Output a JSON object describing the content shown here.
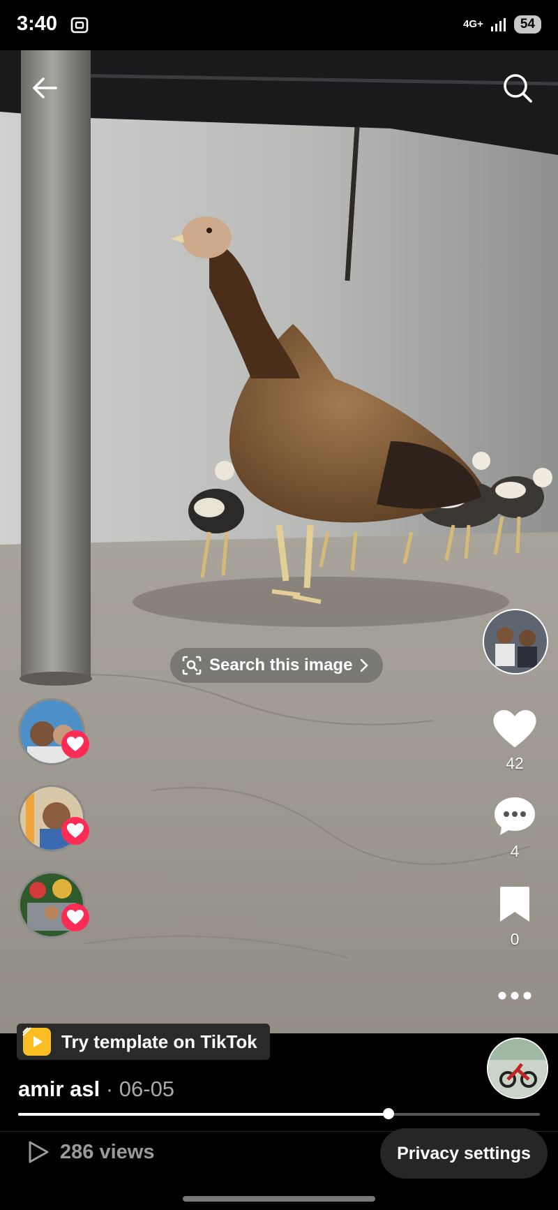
{
  "status_bar": {
    "time": "3:40",
    "network": "4G+",
    "battery": "54"
  },
  "header": {
    "back_icon": "arrow-left-icon",
    "search_icon": "search-icon"
  },
  "search_chip": {
    "label": "Search this image"
  },
  "rail": {
    "likes": "42",
    "comments": "4",
    "saves": "0"
  },
  "bottom": {
    "template_label": "Try template on TikTok",
    "author_name": "amir asl",
    "date": "· 06-05",
    "progress": 0.71,
    "views": "286 views",
    "privacy_label": "Privacy settings"
  },
  "colors": {
    "accent": "#fe2c55",
    "background": "#000000"
  }
}
